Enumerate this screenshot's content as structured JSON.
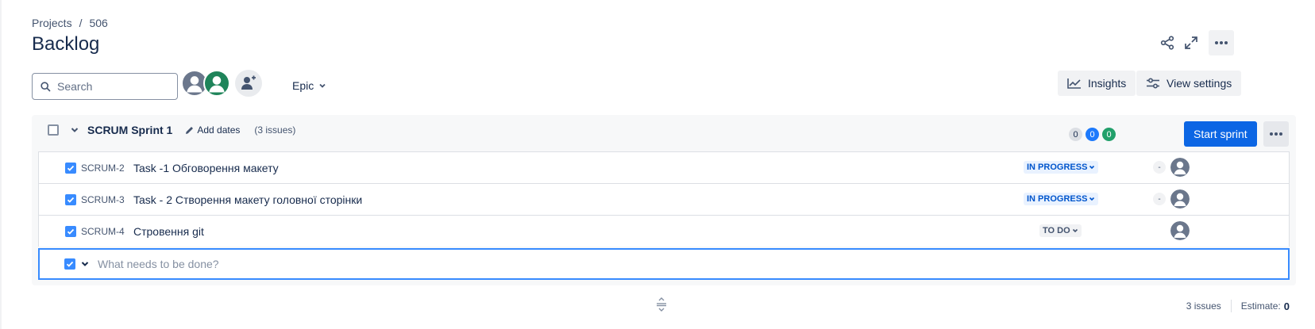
{
  "breadcrumb": {
    "root": "Projects",
    "separator": "/",
    "current": "506"
  },
  "page": {
    "title": "Backlog"
  },
  "header_actions": [
    "share-icon",
    "fullscreen-icon",
    "more-icon"
  ],
  "toolbar": {
    "search_placeholder": "Search",
    "epic_label": "Epic",
    "insights_label": "Insights",
    "view_settings_label": "View settings"
  },
  "sprint": {
    "name": "SCRUM Sprint 1",
    "add_dates_label": "Add dates",
    "issue_count_label": "(3 issues)",
    "counts": {
      "todo": "0",
      "in_progress": "0",
      "done": "0"
    },
    "start_label": "Start sprint"
  },
  "issues": [
    {
      "key": "SCRUM-2",
      "summary": "Task -1 Обговорення макету",
      "status": "IN PROGRESS",
      "estimate": "-"
    },
    {
      "key": "SCRUM-3",
      "summary": "Task - 2 Створення макету головної сторінки",
      "status": "IN PROGRESS",
      "estimate": "-"
    },
    {
      "key": "SCRUM-4",
      "summary": "Стровення git",
      "status": "TO DO",
      "estimate": ""
    }
  ],
  "create": {
    "placeholder": "What needs to be done?"
  },
  "footer": {
    "issues_label": "3 issues",
    "estimate_label": "Estimate:",
    "estimate_value": "0"
  },
  "colors": {
    "primary": "#0c66e4",
    "checkbox": "#388bff",
    "in_progress_bg": "#e9f2ff",
    "in_progress_text": "#0055cc",
    "done_badge": "#22a06b"
  }
}
